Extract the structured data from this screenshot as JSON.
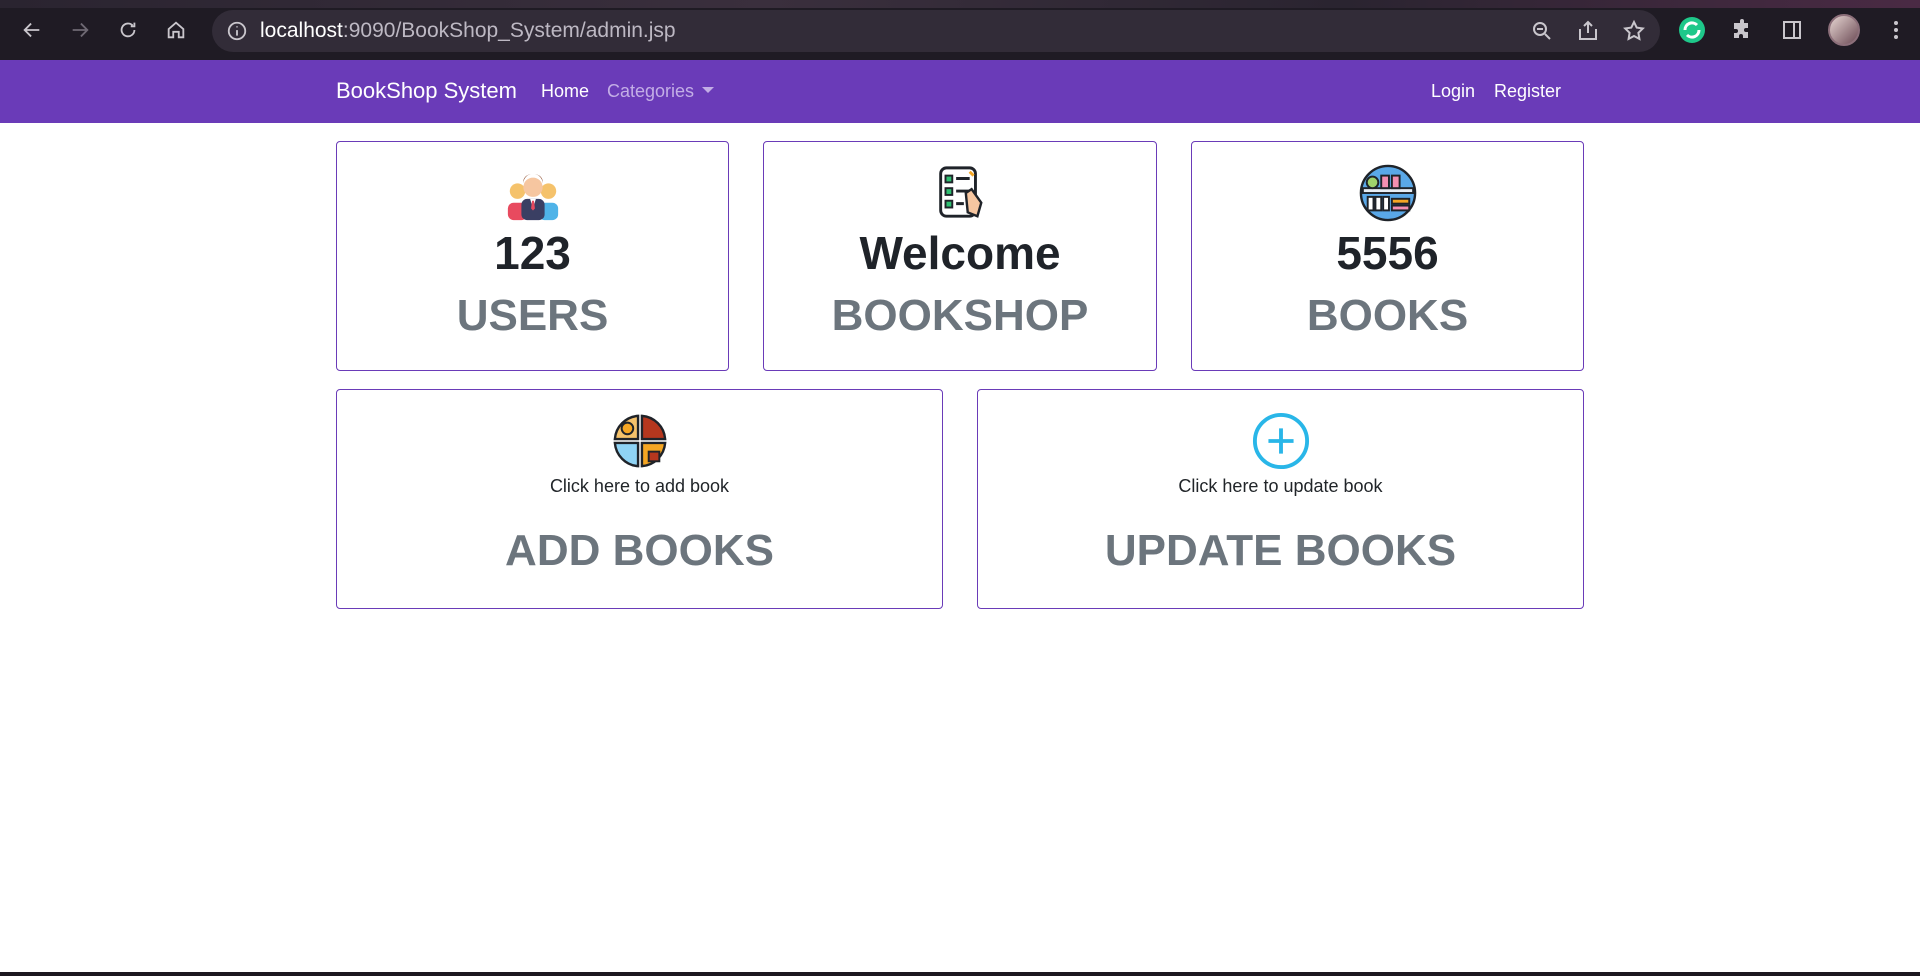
{
  "browser": {
    "url_host": "localhost",
    "url_rest": ":9090/BookShop_System/admin.jsp"
  },
  "navbar": {
    "brand": "BookShop System",
    "links": [
      {
        "label": "Home"
      },
      {
        "label": "Categories"
      }
    ],
    "right_links": [
      {
        "label": "Login"
      },
      {
        "label": "Register"
      }
    ]
  },
  "cards": {
    "users": {
      "value": "123",
      "label": "USERS",
      "icon": "users-icon"
    },
    "welcome": {
      "value": "Welcome",
      "label": "BOOKSHOP",
      "icon": "checklist-icon"
    },
    "books": {
      "value": "5556",
      "label": "BOOKS",
      "icon": "bookshelf-icon"
    },
    "add_books": {
      "desc": "Click here to add book",
      "label": "ADD BOOKS",
      "icon": "commerce-icon"
    },
    "update_books": {
      "desc": "Click here to update book",
      "label": "UPDATE BOOKS",
      "icon": "plus-circle-icon"
    }
  },
  "colors": {
    "navbar": "#6a3bb8",
    "card_border": "#6a3bb8",
    "label_gray": "#6c757d",
    "plus_icon": "#29b6e8"
  }
}
